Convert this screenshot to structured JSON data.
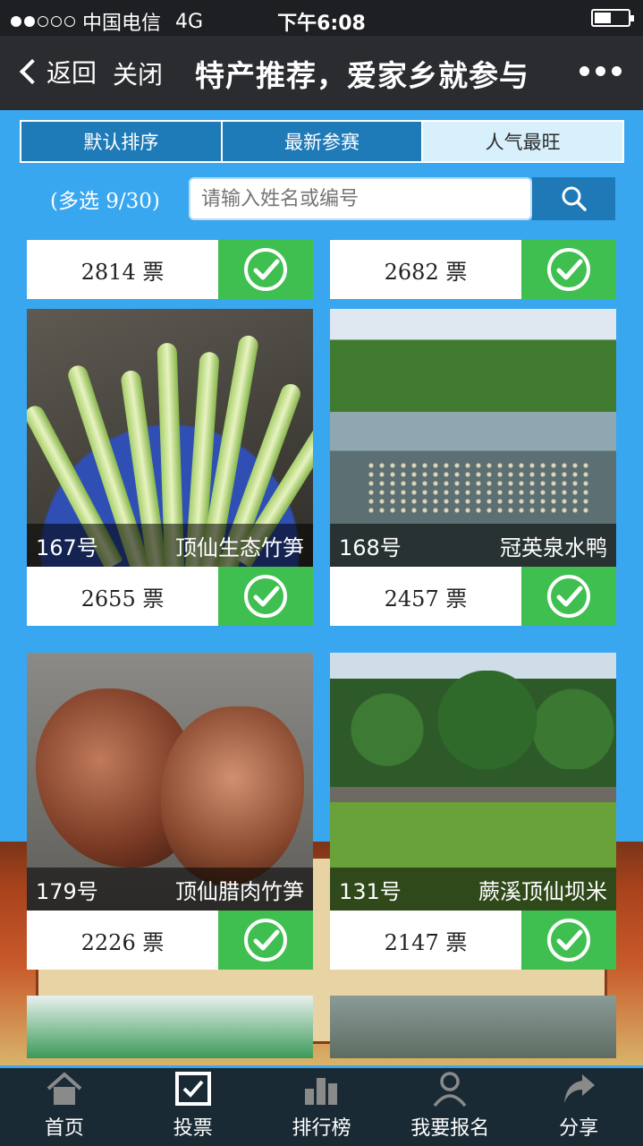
{
  "status_bar": {
    "carrier": "中国电信",
    "network": "4G",
    "time": "下午6:08"
  },
  "nav": {
    "back_label": "返回",
    "close_label": "关闭",
    "title": "特产推荐，爱家乡就参与"
  },
  "tabs": [
    {
      "label": "默认排序",
      "active": false
    },
    {
      "label": "最新参赛",
      "active": false
    },
    {
      "label": "人气最旺",
      "active": true
    }
  ],
  "search": {
    "multi_select": "(多选 9/30)",
    "placeholder": "请输入姓名或编号"
  },
  "partial_top_cards": [
    {
      "votes": "2814 票"
    },
    {
      "votes": "2682 票"
    }
  ],
  "cards": [
    {
      "number": "167号",
      "name": "顶仙生态竹笋",
      "votes": "2655 票"
    },
    {
      "number": "168号",
      "name": "冠英泉水鸭",
      "votes": "2457 票"
    },
    {
      "number": "179号",
      "name": "顶仙腊肉竹笋",
      "votes": "2226 票"
    },
    {
      "number": "131号",
      "name": "蕨溪顶仙坝米",
      "votes": "2147 票"
    }
  ],
  "tab_bar": [
    {
      "label": "首页",
      "icon": "home-icon"
    },
    {
      "label": "投票",
      "icon": "vote-icon"
    },
    {
      "label": "排行榜",
      "icon": "ranking-icon"
    },
    {
      "label": "我要报名",
      "icon": "user-icon"
    },
    {
      "label": "分享",
      "icon": "share-icon"
    }
  ],
  "colors": {
    "page_bg": "#39a6f0",
    "vote_green": "#3ebf4f",
    "nav_bg": "#2b2c30",
    "tab_active_bg": "#d7f0fb"
  }
}
